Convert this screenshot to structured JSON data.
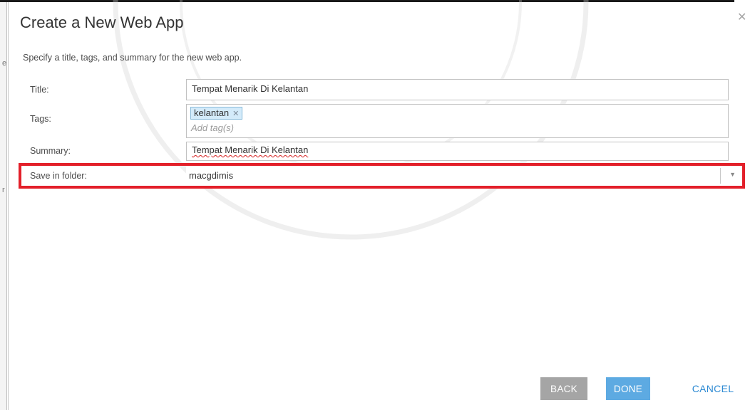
{
  "dialog": {
    "title": "Create a New Web App",
    "subtitle": "Specify a title, tags, and summary for the new web app.",
    "close_icon": "close-icon"
  },
  "form": {
    "title_label": "Title:",
    "title_value": "Tempat Menarik Di Kelantan",
    "tags_label": "Tags:",
    "tags": [
      "kelantan"
    ],
    "tags_placeholder": "Add tag(s)",
    "summary_label": "Summary:",
    "summary_value": "Tempat Menarik Di Kelantan",
    "folder_label": "Save in folder:",
    "folder_value": "macgdimis"
  },
  "buttons": {
    "back": "BACK",
    "done": "DONE",
    "cancel": "CANCEL"
  },
  "colors": {
    "highlight": "#e3202a",
    "done": "#5daae2",
    "back": "#a5a5a5",
    "cancel_text": "#2d8ad3",
    "tag_chip": "#d4ebfa"
  }
}
